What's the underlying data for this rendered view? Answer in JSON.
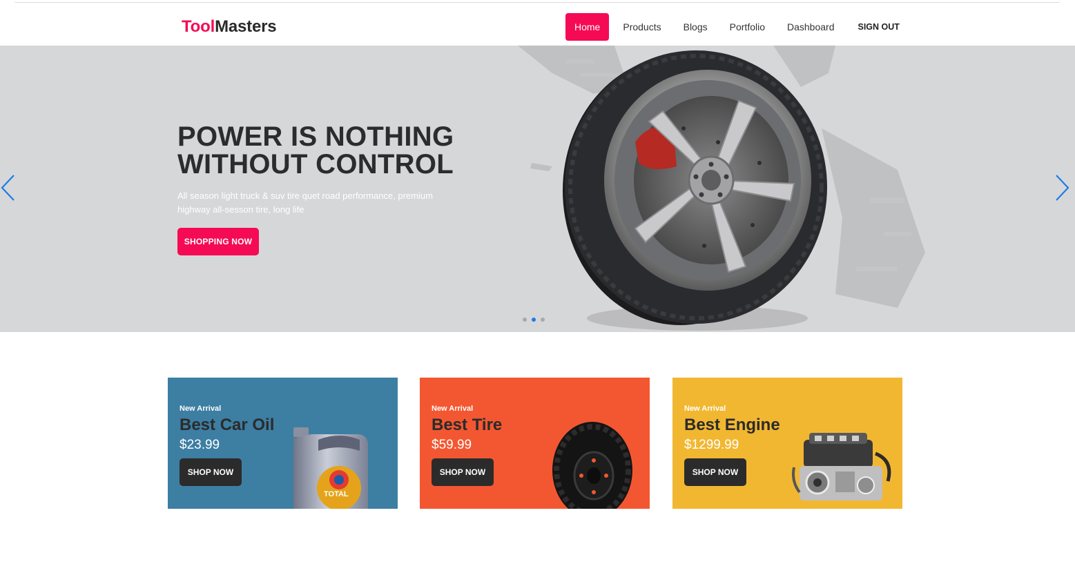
{
  "header": {
    "brand_part1": "Tool",
    "brand_part2": "Masters",
    "nav": [
      {
        "label": "Home",
        "active": true
      },
      {
        "label": "Products"
      },
      {
        "label": "Blogs"
      },
      {
        "label": "Portfolio"
      },
      {
        "label": "Dashboard"
      },
      {
        "label": "SIGN OUT"
      }
    ]
  },
  "hero": {
    "title_line1": "POWER IS NOTHING",
    "title_line2": "WITHOUT CONTROL",
    "subtitle": "All season light truck & suv tire quet road performance, premium highway all-sesson tire, long life",
    "button": "SHOPPING NOW",
    "active_slide": 2,
    "slide_count": 3,
    "prev_icon": "chevron-left-icon",
    "next_icon": "chevron-right-icon",
    "arrow_color": "#1e7be6"
  },
  "cards": [
    {
      "tag": "New Arrival",
      "title": "Best Car Oil",
      "price": "$23.99",
      "button": "SHOP NOW",
      "color": "#3d7ea3",
      "image": "motor-oil-can"
    },
    {
      "tag": "New Arrival",
      "title": "Best Tire",
      "price": "$59.99",
      "button": "SHOP NOW",
      "color": "#f35731",
      "image": "tire"
    },
    {
      "tag": "New Arrival",
      "title": "Best Engine",
      "price": "$1299.99",
      "button": "SHOP NOW",
      "color": "#f2b731",
      "image": "car-engine"
    }
  ],
  "colors": {
    "accent": "#f50a55",
    "hero_bg": "#d6d7d9",
    "dark": "#2b2b2b"
  }
}
